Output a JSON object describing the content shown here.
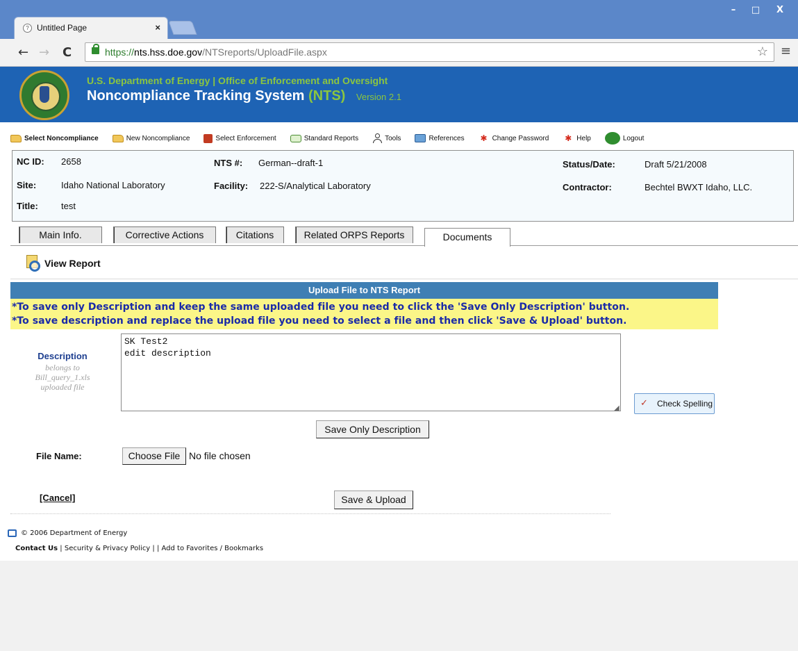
{
  "browser": {
    "tab_title": "Untitled Page",
    "tab_close": "×",
    "window_controls": [
      "–",
      "□",
      "X"
    ],
    "nav_back": "←",
    "nav_forward": "→",
    "nav_reload": "C",
    "url_scheme": "https://",
    "url_host": "nts.hss.doe.gov",
    "url_path": "/NTSreports/UploadFile.aspx",
    "star_glyph": "☆",
    "menu_glyph": "≡"
  },
  "header": {
    "agency": "U.S. Department of Energy | Office of Enforcement and Oversight",
    "system_name": "Noncompliance Tracking System",
    "system_abbr": "(NTS)",
    "version": "Version 2.1"
  },
  "menu": {
    "items": [
      {
        "label": "Select Noncompliance",
        "icon": "folder-icon"
      },
      {
        "label": "New Noncompliance",
        "icon": "folder-icon"
      },
      {
        "label": "Select Enforcement",
        "icon": "enforcement-icon"
      },
      {
        "label": "Standard Reports",
        "icon": "reports-icon"
      },
      {
        "label": "Tools",
        "icon": "user-icon"
      },
      {
        "label": "References",
        "icon": "references-icon"
      },
      {
        "label": "Change Password",
        "icon": "key-icon"
      },
      {
        "label": "Help",
        "icon": "help-icon"
      },
      {
        "label": "Logout",
        "icon": "logout-icon"
      }
    ]
  },
  "record": {
    "nc_id_label": "NC ID:",
    "nc_id": "2658",
    "nts_label": "NTS #:",
    "nts": "German--draft-1",
    "status_label": "Status/Date:",
    "status": "Draft 5/21/2008",
    "site_label": "Site:",
    "site": "Idaho National Laboratory",
    "facility_label": "Facility:",
    "facility": "222-S/Analytical Laboratory",
    "contractor_label": "Contractor:",
    "contractor": "Bechtel BWXT Idaho, LLC.",
    "title_label": "Title:",
    "title": "test"
  },
  "tabs": [
    "Main Info.",
    "Corrective Actions",
    "Citations",
    "Related ORPS Reports",
    "Documents"
  ],
  "active_tab": "Documents",
  "view_report": "View Report",
  "upload": {
    "title": "Upload File to NTS Report",
    "notice_1": "*To save only Description and keep the same uploaded file you need to click the 'Save Only Description' button.",
    "notice_2": "*To save description and replace the upload file you need to select a file and then click 'Save & Upload' button.",
    "description_label": "Description",
    "description_help_1": "belongs to",
    "description_help_2": "Bill_query_1.xls",
    "description_help_3": "uploaded file",
    "description_value": "SK Test2\nedit description",
    "check_spelling": "Check Spelling",
    "save_only_description": "Save Only Description",
    "file_name_label": "File Name:",
    "choose_file": "Choose File",
    "no_file": "No file chosen",
    "cancel": "[Cancel]",
    "save_upload": "Save & Upload"
  },
  "footer": {
    "copyright": "© 2006 Department of Energy",
    "contact": "Contact Us",
    "privacy": "Security & Privacy Policy",
    "favorites": "Add to Favorites / Bookmarks",
    "sep1": " | ",
    "sep2": " | | "
  },
  "colors": {
    "header_blue": "#1e63b4",
    "header_green": "#8cc63f",
    "upload_bar": "#3f7fb4",
    "notice_bg": "#fbf688",
    "notice_text": "#1a2aa8"
  }
}
